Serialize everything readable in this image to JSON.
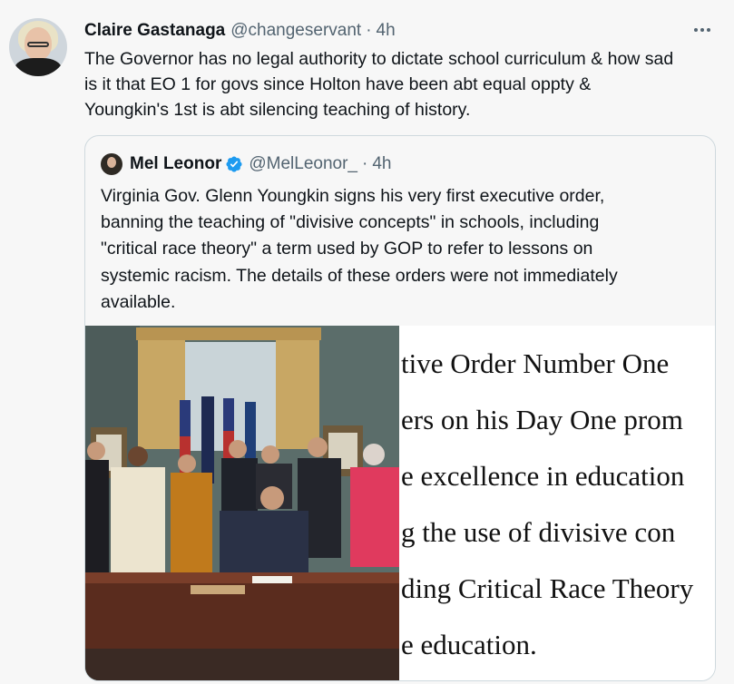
{
  "tweet": {
    "author_name": "Claire Gastanaga",
    "handle": "@changeservant",
    "separator": "·",
    "time": "4h",
    "text_lines": [
      "The Governor has no legal authority to dictate school curriculum & how sad",
      "is it that EO 1 for govs since Holton have been abt equal oppty  &",
      "Youngkin's 1st is abt silencing teaching of history."
    ],
    "more_icon": "more-horizontal-icon"
  },
  "quote": {
    "author_name": "Mel Leonor",
    "verified_icon": "verified-badge-icon",
    "handle": "@MelLeonor_",
    "separator": "·",
    "time": "4h",
    "text_lines": [
      "Virginia Gov. Glenn Youngkin signs his very first executive order,",
      "banning the teaching of \"divisive concepts\" in schools, including",
      "\"critical race theory\" a term used by GOP to refer to lessons on",
      "systemic racism. The details of these orders were not immediately",
      "available."
    ],
    "document_lines": [
      "tive Order Number One",
      "ers on his Day One prom",
      "e excellence in education",
      "g the use of divisive con",
      "ding Critical Race Theory",
      "e education."
    ]
  },
  "colors": {
    "background": "#f7f7f7",
    "text_primary": "#0f1419",
    "text_secondary": "#536471",
    "border": "#cfd9de",
    "verified": "#1d9bf0"
  }
}
